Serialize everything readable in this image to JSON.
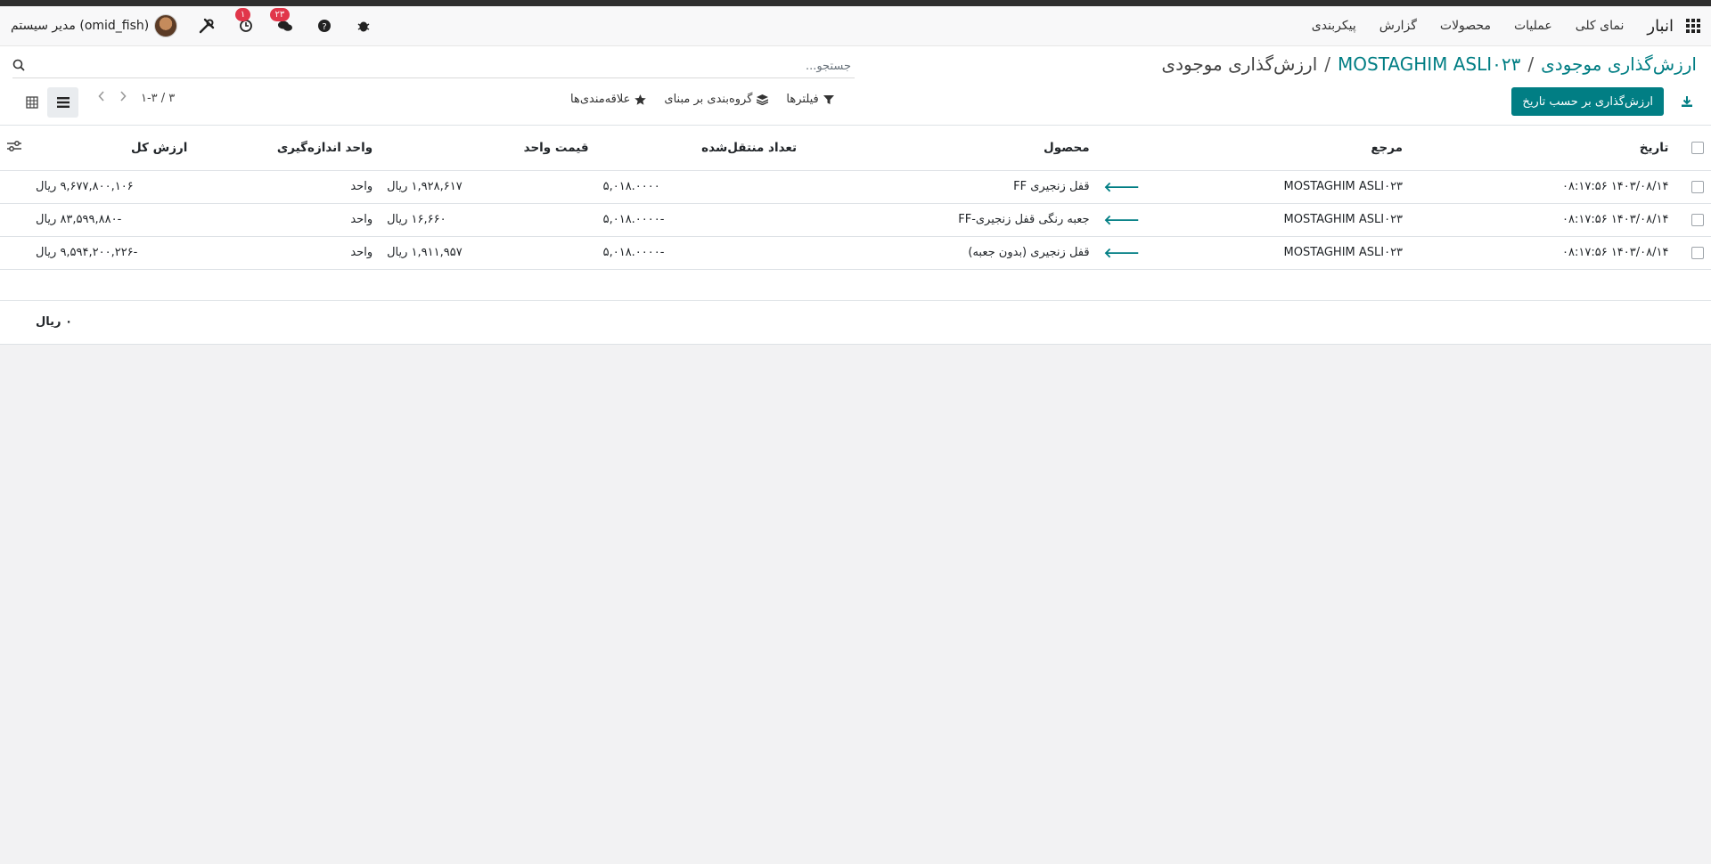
{
  "navbar": {
    "brand": "انبار",
    "menu": [
      "نمای کلی",
      "عملیات",
      "محصولات",
      "گزارش",
      "پیکربندی"
    ],
    "user_name": "مدیر سیستم (omid_fish)",
    "chat_badge": "۲۳",
    "activity_badge": "۱"
  },
  "breadcrumb": {
    "root": "ارزش‌گذاری موجودی",
    "middle": "MOSTAGHIM ASLI۰۲۳",
    "current": "ارزش‌گذاری موجودی"
  },
  "search": {
    "placeholder": "جستجو..."
  },
  "toolbar": {
    "primary_label": "ارزش‌گذاری بر حسب تاریخ",
    "filters_label": "فیلترها",
    "groupby_label": "گروه‌بندی بر مبنای",
    "favorites_label": "علاقه‌مندی‌ها",
    "pager_value": "۱-۳ / ۳"
  },
  "table": {
    "headers": [
      "تاریخ",
      "مرجع",
      "محصول",
      "تعداد منتقل‌شده",
      "قیمت واحد",
      "واحد اندازه‌گیری",
      "ارزش کل"
    ],
    "rows": [
      {
        "date": "۱۴۰۳/۰۸/۱۴ ۰۸:۱۷:۵۶",
        "ref": "MOSTAGHIM ASLI۰۲۳",
        "product": "قفل زنجیری FF",
        "qty": "۵,۰۱۸.۰۰۰۰",
        "unit_price": "۱,۹۲۸,۶۱۷ ریال",
        "uom": "واحد",
        "total": "۹,۶۷۷,۸۰۰,۱۰۶ ریال"
      },
      {
        "date": "۱۴۰۳/۰۸/۱۴ ۰۸:۱۷:۵۶",
        "ref": "MOSTAGHIM ASLI۰۲۳",
        "product": "جعبه رنگی قفل زنجیری-FF",
        "qty": "-۵,۰۱۸.۰۰۰۰",
        "unit_price": "۱۶,۶۶۰ ریال",
        "uom": "واحد",
        "total": "-۸۳,۵۹۹,۸۸۰ ریال"
      },
      {
        "date": "۱۴۰۳/۰۸/۱۴ ۰۸:۱۷:۵۶",
        "ref": "MOSTAGHIM ASLI۰۲۳",
        "product": "قفل زنجیری (بدون جعبه)",
        "qty": "-۵,۰۱۸.۰۰۰۰",
        "unit_price": "۱,۹۱۱,۹۵۷ ریال",
        "uom": "واحد",
        "total": "-۹,۵۹۴,۲۰۰,۲۲۶ ریال"
      }
    ],
    "footer_total": "۰ ریال"
  },
  "colors": {
    "accent": "#017e84",
    "badge": "#e1364a"
  },
  "icons": {
    "apps": "apps-grid-icon",
    "bug": "bug-icon",
    "help": "question-circle-icon",
    "chat": "chat-icon",
    "activity": "clock-icon",
    "settings": "tools-icon",
    "search": "search-icon",
    "download": "download-icon",
    "filter": "filter-icon",
    "groupby": "layers-icon",
    "favorite": "star-icon",
    "list_view": "list-view-icon",
    "grid_view": "grid-view-icon",
    "optional_columns": "sliders-icon",
    "arrow": "arrow-left-icon"
  }
}
